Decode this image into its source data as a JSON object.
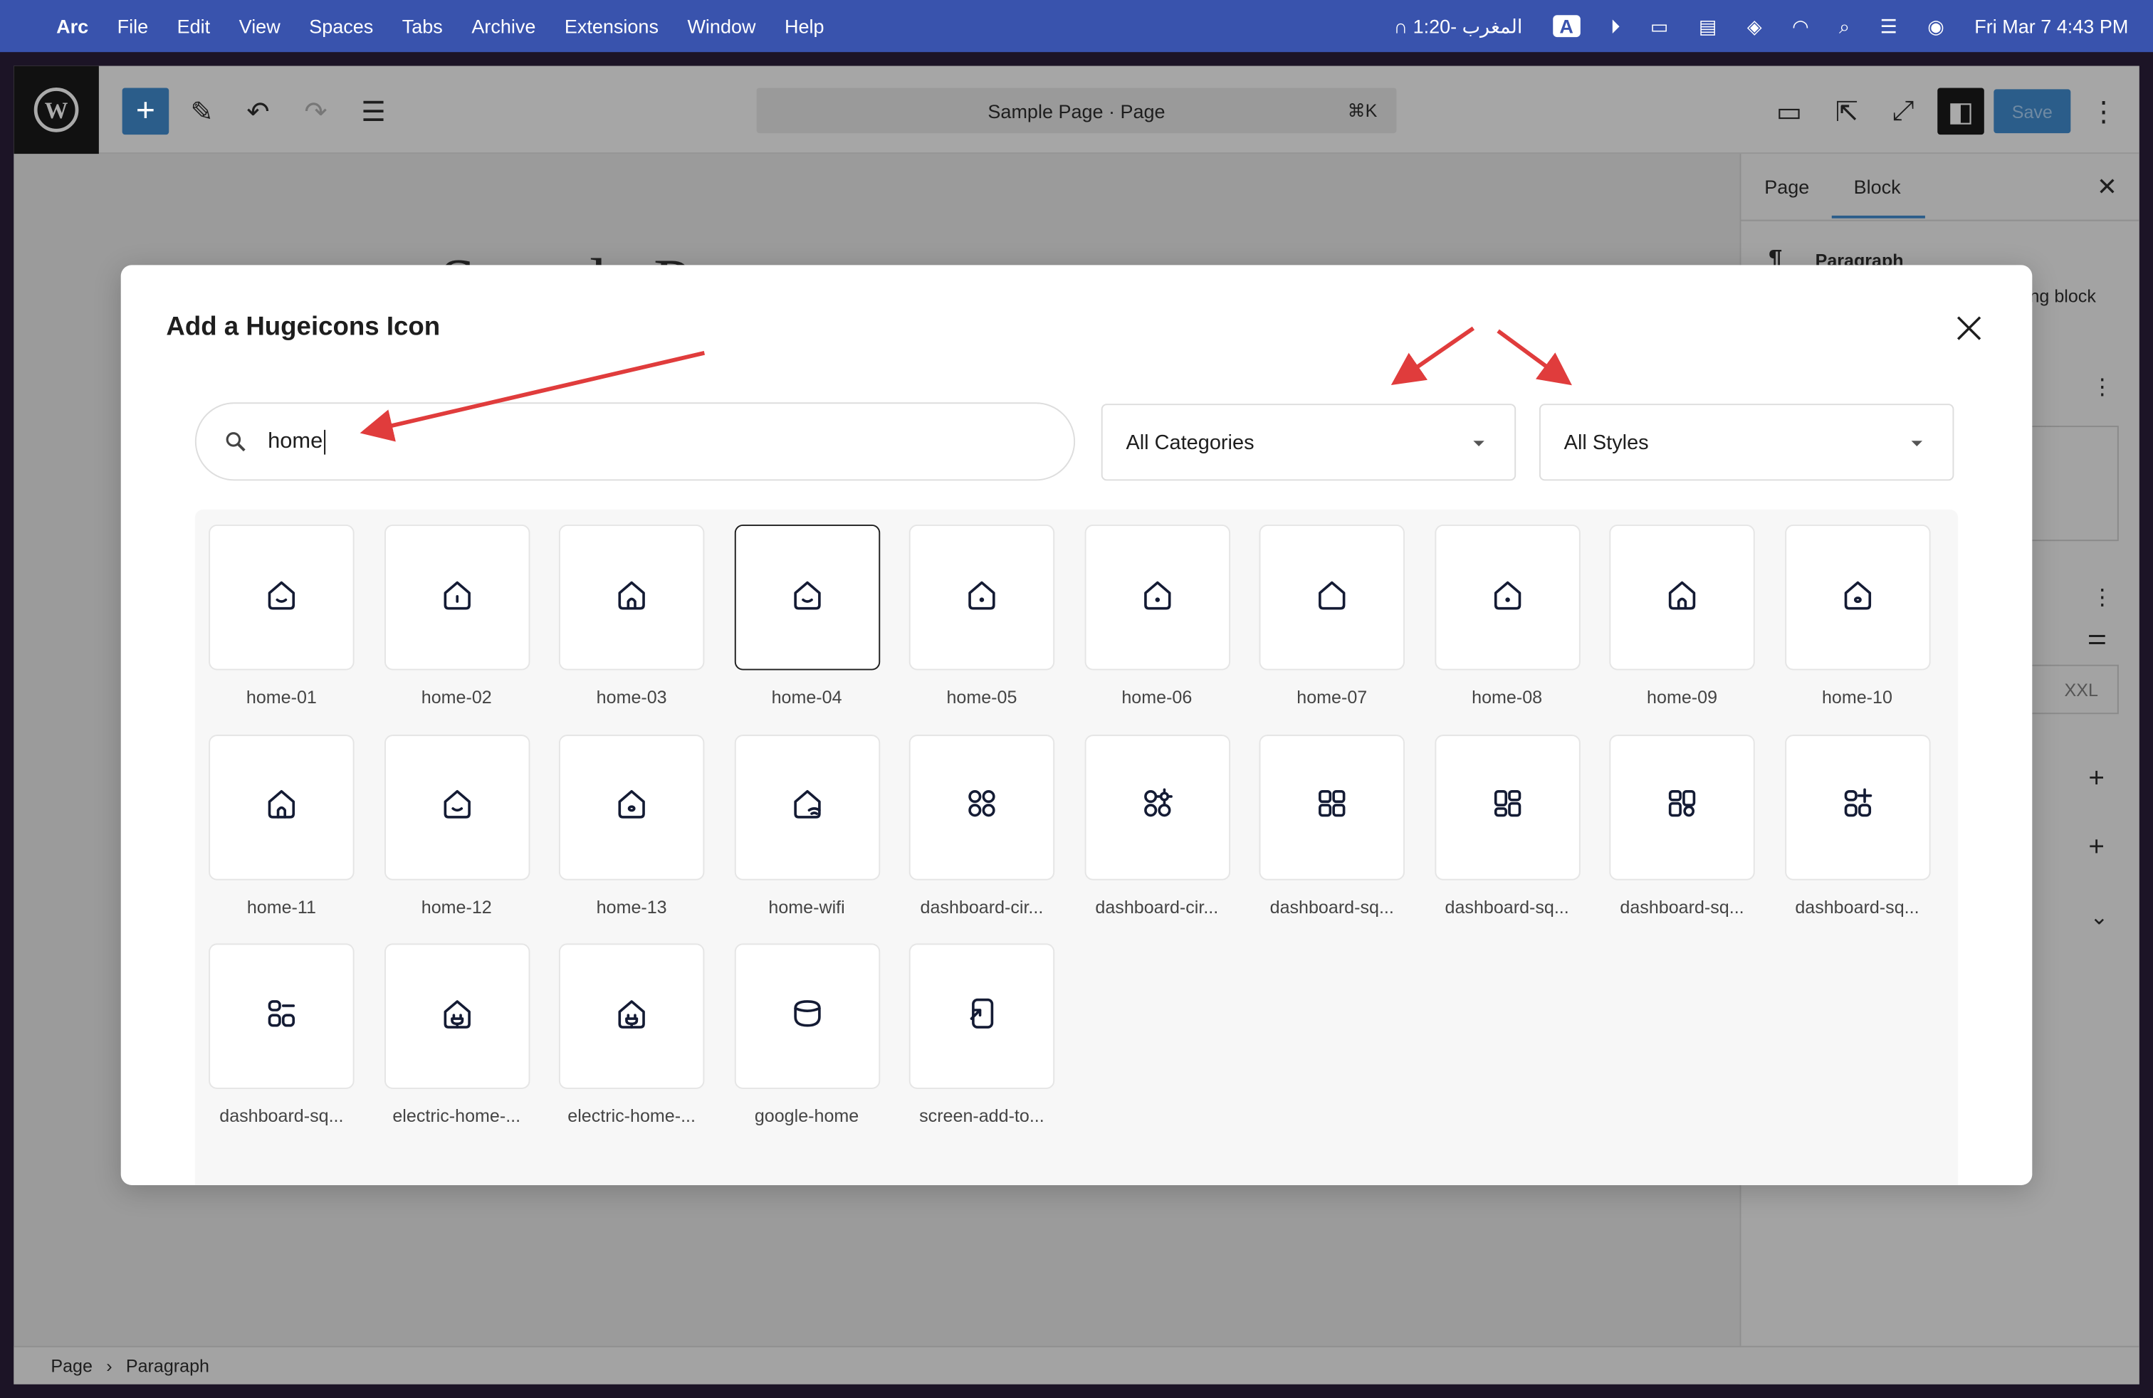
{
  "menubar": {
    "app": "Arc",
    "items": [
      "File",
      "Edit",
      "View",
      "Spaces",
      "Tabs",
      "Archive",
      "Extensions",
      "Window",
      "Help"
    ],
    "prayer": "المغرب -1:20",
    "datetime": "Fri Mar 7  4:43 PM",
    "input_source": "A"
  },
  "toolbar": {
    "document_title": "Sample Page · Page",
    "shortcut": "⌘K",
    "save_label": "Save"
  },
  "sidebar": {
    "tabs": [
      "Page",
      "Block"
    ],
    "active_tab": "Block",
    "block_name": "Paragraph",
    "block_desc": "ng block",
    "size_option": "XXL"
  },
  "canvas": {
    "title": "Sample Page"
  },
  "footer": {
    "breadcrumb": [
      "Page",
      "Paragraph"
    ]
  },
  "modal": {
    "title": "Add a Hugeicons Icon",
    "search": {
      "value": "home",
      "placeholder": ""
    },
    "category_select": "All Categories",
    "style_select": "All Styles",
    "selected": "home-04",
    "icons": [
      {
        "label": "home-01",
        "kind": "home-smile"
      },
      {
        "label": "home-02",
        "kind": "home-line"
      },
      {
        "label": "home-03",
        "kind": "home-arch"
      },
      {
        "label": "home-04",
        "kind": "home-smile"
      },
      {
        "label": "home-05",
        "kind": "home-dot"
      },
      {
        "label": "home-06",
        "kind": "home-dot"
      },
      {
        "label": "home-07",
        "kind": "home-plain"
      },
      {
        "label": "home-08",
        "kind": "home-dot"
      },
      {
        "label": "home-09",
        "kind": "home-arch"
      },
      {
        "label": "home-10",
        "kind": "home-circle"
      },
      {
        "label": "home-11",
        "kind": "home-arch"
      },
      {
        "label": "home-12",
        "kind": "home-smile"
      },
      {
        "label": "home-13",
        "kind": "home-circle"
      },
      {
        "label": "home-wifi",
        "kind": "home-wifi"
      },
      {
        "label": "dashboard-cir...",
        "kind": "dash-circle"
      },
      {
        "label": "dashboard-cir...",
        "kind": "dash-gear"
      },
      {
        "label": "dashboard-sq...",
        "kind": "dash-square"
      },
      {
        "label": "dashboard-sq...",
        "kind": "dash-mixed"
      },
      {
        "label": "dashboard-sq...",
        "kind": "dash-mixed2"
      },
      {
        "label": "dashboard-sq...",
        "kind": "dash-plus"
      },
      {
        "label": "dashboard-sq...",
        "kind": "dash-minus"
      },
      {
        "label": "electric-home-...",
        "kind": "home-plug"
      },
      {
        "label": "electric-home-...",
        "kind": "home-plug"
      },
      {
        "label": "google-home",
        "kind": "google-home"
      },
      {
        "label": "screen-add-to...",
        "kind": "screen-add"
      }
    ]
  },
  "colors": {
    "menubar": "#3953ad",
    "accent": "#2b5d8a",
    "annotation_arrow": "#e03c3c",
    "icon_stroke": "#141b34"
  }
}
